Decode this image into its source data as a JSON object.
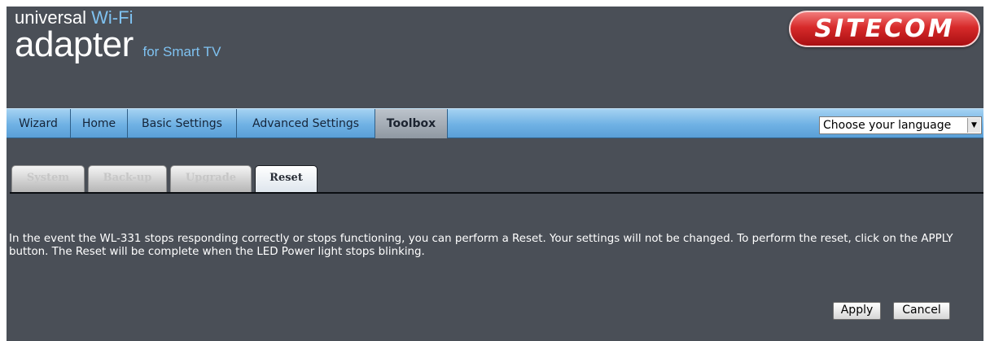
{
  "header": {
    "brand_line1_prefix": "universal ",
    "brand_line1_accent": "Wi-Fi",
    "brand_line2_main": "adapter",
    "brand_line2_accent": "for Smart TV",
    "logo_text": "SITECOM"
  },
  "nav": {
    "items": [
      {
        "label": "Wizard"
      },
      {
        "label": "Home"
      },
      {
        "label": "Basic Settings"
      },
      {
        "label": "Advanced Settings"
      },
      {
        "label": "Toolbox"
      }
    ],
    "active": "Toolbox",
    "language_select": {
      "value": "Choose your language",
      "icon": "chevron-down-icon"
    }
  },
  "subtabs": {
    "items": [
      {
        "label": "System"
      },
      {
        "label": "Back-up"
      },
      {
        "label": "Upgrade"
      },
      {
        "label": "Reset"
      }
    ],
    "active": "Reset"
  },
  "content": {
    "description": "In the event the WL-331 stops responding correctly or stops functioning, you can perform a Reset. Your settings will not be changed. To perform the reset, click on the APPLY button. The Reset will be complete when the LED Power light stops blinking."
  },
  "actions": {
    "apply_label": "Apply",
    "cancel_label": "Cancel"
  },
  "colors": {
    "background": "#4a4f57",
    "accent": "#7fc2f1",
    "nav": "#6fb1e4",
    "logo": "#d72a2a"
  }
}
